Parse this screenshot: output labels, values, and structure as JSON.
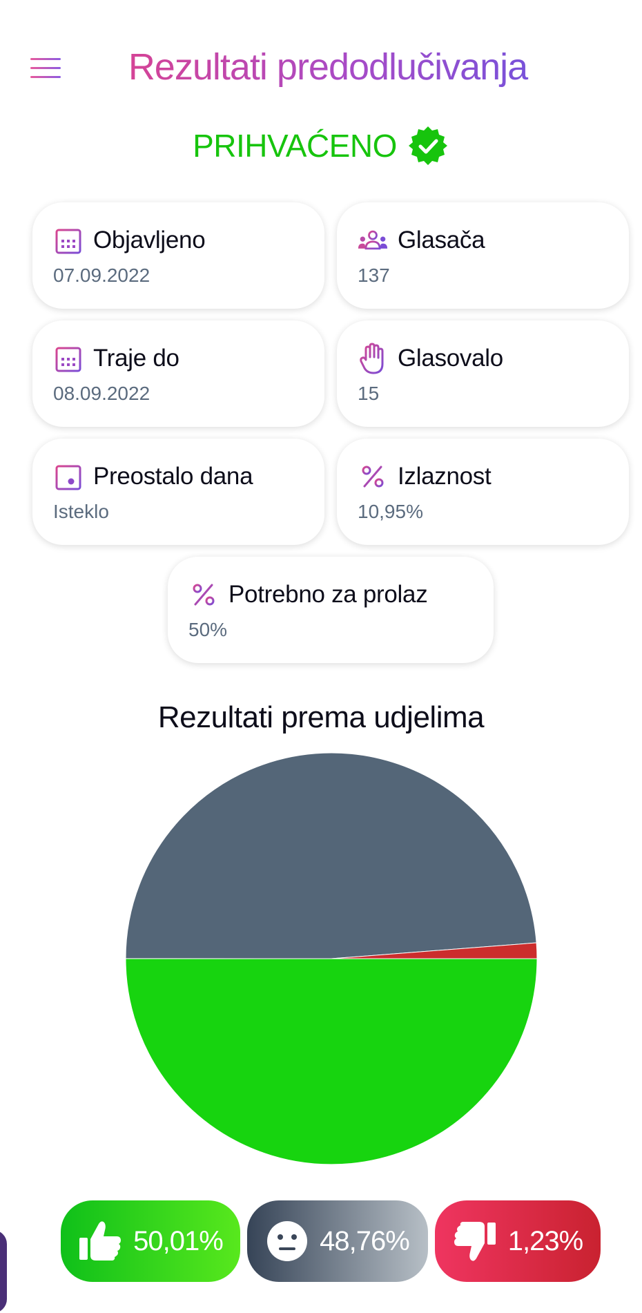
{
  "header": {
    "title": "Rezultati predodlučivanja",
    "menu_icon": "hamburger-menu-icon"
  },
  "status": {
    "text": "PRIHVAĆENO",
    "icon": "verified-badge-icon",
    "color": "#17c40d"
  },
  "stats": [
    {
      "label": "Objavljeno",
      "value": "07.09.2022",
      "icon": "calendar-icon"
    },
    {
      "label": "Glasača",
      "value": "137",
      "icon": "users-icon"
    },
    {
      "label": "Traje do",
      "value": "08.09.2022",
      "icon": "calendar-icon"
    },
    {
      "label": "Glasovalo",
      "value": "15",
      "icon": "hand-icon"
    },
    {
      "label": "Preostalo dana",
      "value": "Isteklo",
      "icon": "calendar-day-icon"
    },
    {
      "label": "Izlaznost",
      "value": "10,95%",
      "icon": "percent-icon"
    },
    {
      "label": "Potrebno za prolaz",
      "value": "50%",
      "icon": "percent-icon"
    }
  ],
  "chart_data": {
    "type": "pie",
    "title": "Rezultati prema udjelima",
    "categories": [
      "Za",
      "Suzdržano",
      "Protiv"
    ],
    "values": [
      50.01,
      48.76,
      1.23
    ],
    "colors": [
      "#17d40f",
      "#546678",
      "#cc2d2d"
    ]
  },
  "results": {
    "yes": {
      "value": "50,01%",
      "icon": "thumbs-up-icon"
    },
    "abstain": {
      "value": "48,76%",
      "icon": "neutral-face-icon"
    },
    "no": {
      "value": "1,23%",
      "icon": "thumbs-down-icon"
    }
  },
  "colors": {
    "accent_gradient_start": "#ef3f7a",
    "accent_gradient_end": "#5a56e6",
    "muted_text": "#5b6b7e"
  }
}
